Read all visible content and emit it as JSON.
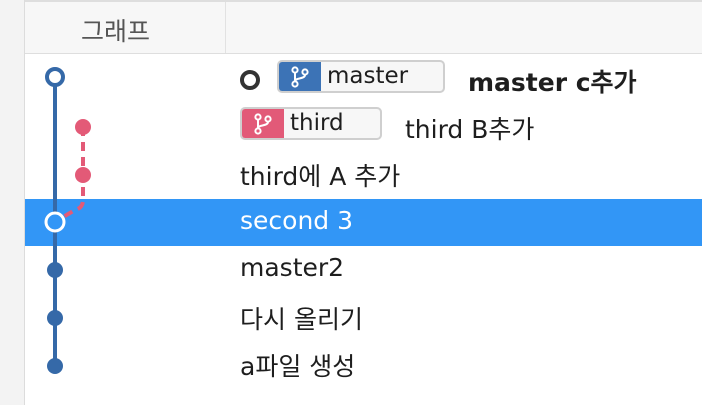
{
  "header": {
    "graph_label": "그래프"
  },
  "colors": {
    "master_branch": "#3569a8",
    "third_branch": "#e35a77",
    "selected_row": "#3296f6"
  },
  "commits": [
    {
      "message": "master c추가",
      "is_head": true,
      "branch_badge": {
        "label": "master",
        "icon": "git-branch-icon",
        "color": "#3c73b6"
      }
    },
    {
      "message": "third B추가",
      "branch_badge": {
        "label": "third",
        "icon": "git-branch-icon",
        "color": "#e25a78"
      }
    },
    {
      "message": "third에 A 추가"
    },
    {
      "message": "second 3",
      "selected": true
    },
    {
      "message": "master2"
    },
    {
      "message": "다시 올리기"
    },
    {
      "message": "a파일 생성"
    }
  ]
}
